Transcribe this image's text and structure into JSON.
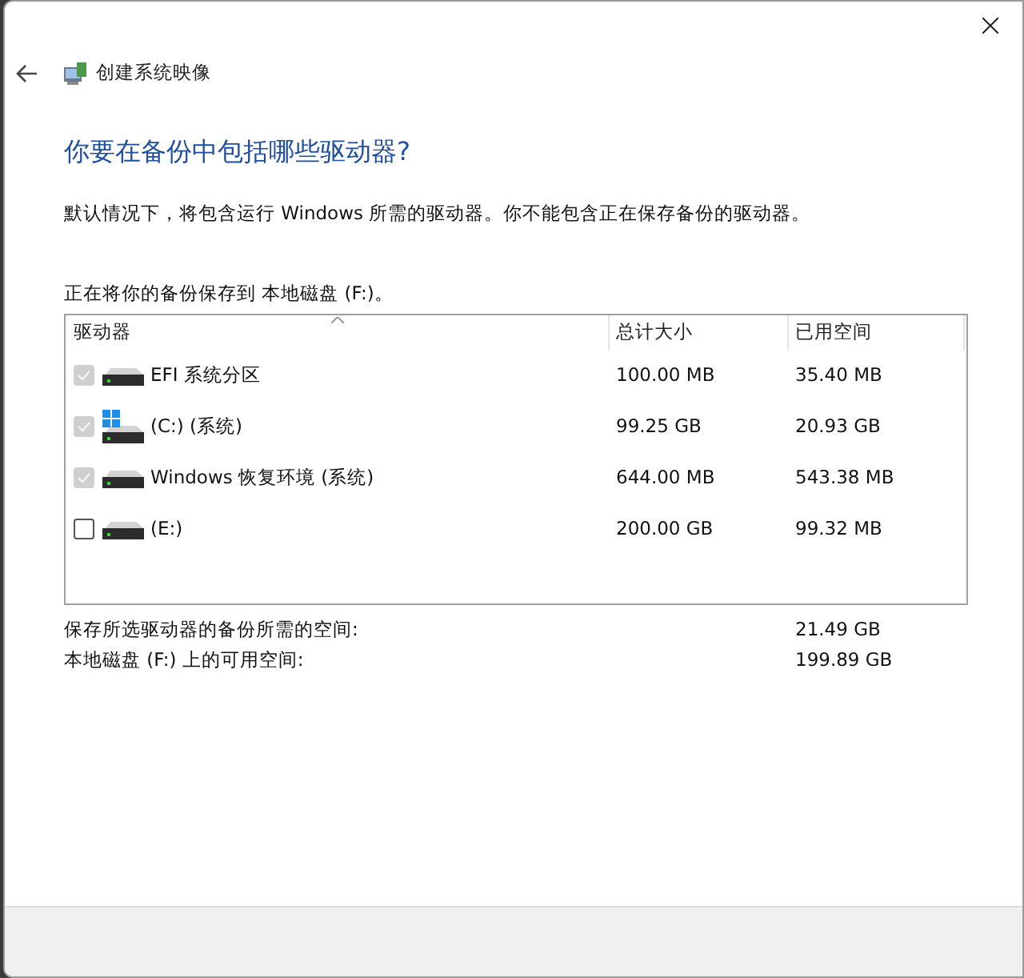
{
  "window": {
    "title": "创建系统映像"
  },
  "heading": "你要在备份中包括哪些驱动器?",
  "description": "默认情况下，将包含运行 Windows 所需的驱动器。你不能包含正在保存备份的驱动器。",
  "destination": "正在将你的备份保存到 本地磁盘 (F:)。",
  "table": {
    "columns": [
      "驱动器",
      "总计大小",
      "已用空间"
    ],
    "rows": [
      {
        "kind": "drive",
        "name": "EFI 系统分区",
        "total": "100.00 MB",
        "used": "35.40 MB",
        "checked": true,
        "disabled": true
      },
      {
        "kind": "system_drive",
        "name": "(C:) (系统)",
        "total": "99.25 GB",
        "used": "20.93 GB",
        "checked": true,
        "disabled": true
      },
      {
        "kind": "drive",
        "name": "Windows 恢复环境 (系统)",
        "total": "644.00 MB",
        "used": "543.38 MB",
        "checked": true,
        "disabled": true
      },
      {
        "kind": "drive",
        "name": "(E:)",
        "total": "200.00 GB",
        "used": "99.32 MB",
        "checked": false,
        "disabled": false
      }
    ]
  },
  "summary": [
    {
      "label": "保存所选驱动器的备份所需的空间:",
      "value": "21.49 GB"
    },
    {
      "label": "本地磁盘 (F:) 上的可用空间:",
      "value": "199.89 GB"
    }
  ]
}
